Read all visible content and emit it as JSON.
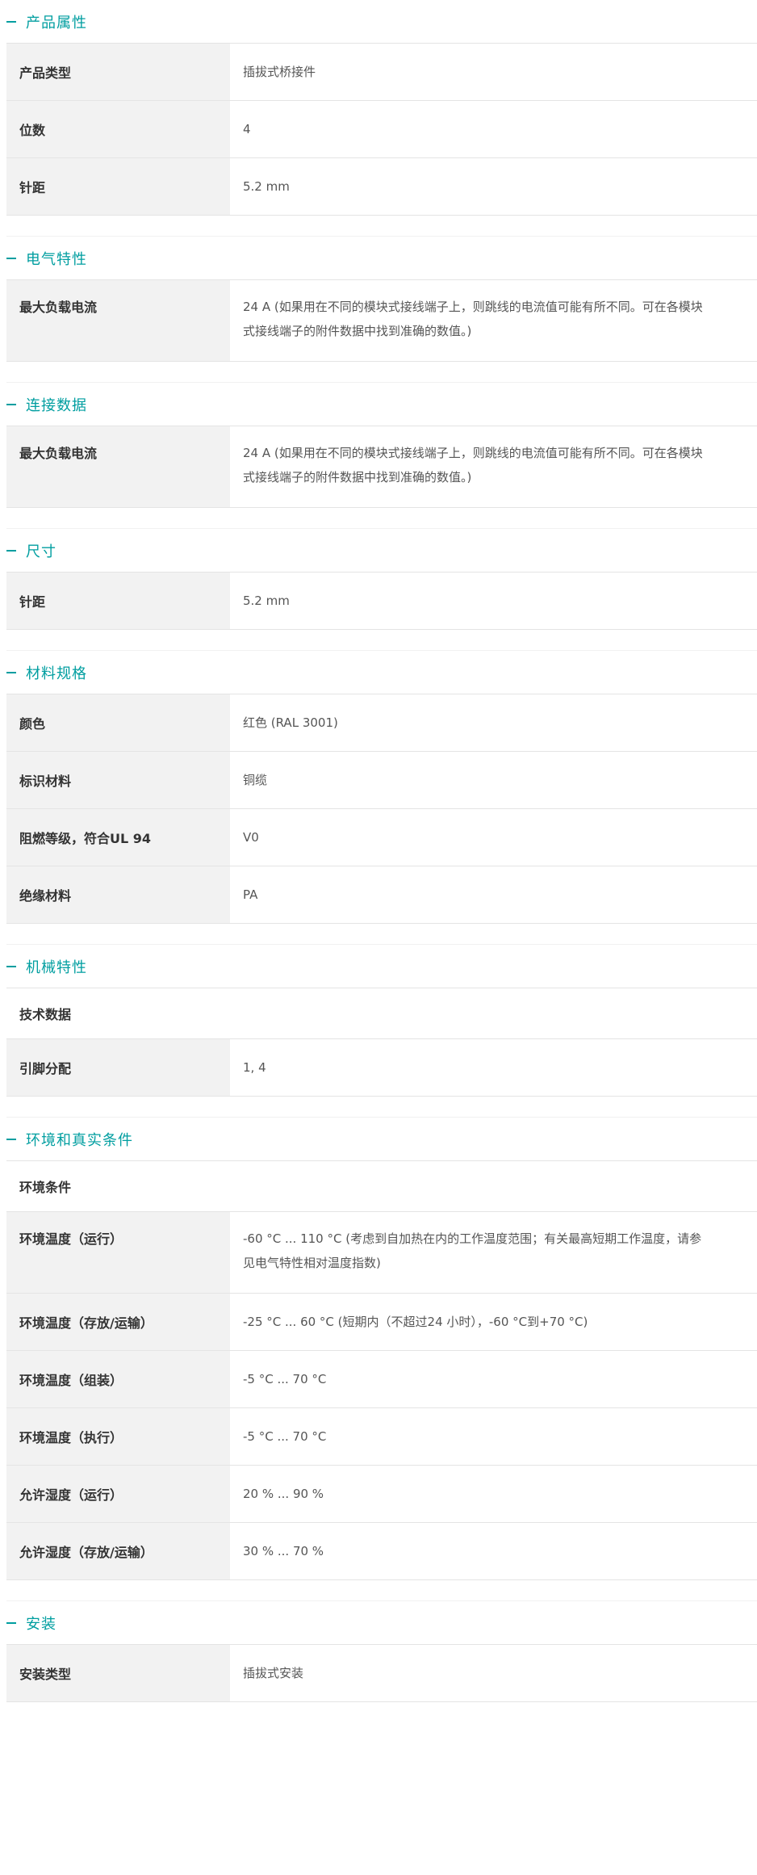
{
  "sections": [
    {
      "title": "产品属性",
      "rows": [
        {
          "key": "产品类型",
          "value": "插拔式桥接件"
        },
        {
          "key": "位数",
          "value": "4"
        },
        {
          "key": "针距",
          "value": "5.2 mm"
        }
      ]
    },
    {
      "title": "电气特性",
      "rows": [
        {
          "key": "最大负载电流",
          "value_line1": "24 A (如果用在不同的模块式接线端子上，则跳线的电流值可能有所不同。可在各模块",
          "value_line2": "式接线端子的附件数据中找到准确的数值。)"
        }
      ]
    },
    {
      "title": "连接数据",
      "rows": [
        {
          "key": "最大负载电流",
          "value_line1": "24 A (如果用在不同的模块式接线端子上，则跳线的电流值可能有所不同。可在各模块",
          "value_line2": "式接线端子的附件数据中找到准确的数值。)"
        }
      ]
    },
    {
      "title": "尺寸",
      "rows": [
        {
          "key": "针距",
          "value": "5.2 mm"
        }
      ]
    },
    {
      "title": "材料规格",
      "rows": [
        {
          "key": "颜色",
          "value": "红色 (RAL 3001)"
        },
        {
          "key": "标识材料",
          "value": "铜缆"
        },
        {
          "key": "阻燃等级，符合UL 94",
          "value": "V0"
        },
        {
          "key": "绝缘材料",
          "value": "PA"
        }
      ]
    },
    {
      "title": "机械特性",
      "subhead": "技术数据",
      "rows": [
        {
          "key": "引脚分配",
          "value": "1, 4"
        }
      ]
    },
    {
      "title": "环境和真实条件",
      "subhead": "环境条件",
      "rows": [
        {
          "key": "环境温度（运行）",
          "value_line1": "-60 °C ... 110 °C (考虑到自加热在内的工作温度范围；有关最高短期工作温度，请参",
          "value_line2": "见电气特性相对温度指数)"
        },
        {
          "key": "环境温度（存放/运输）",
          "value": "-25 °C ... 60 °C (短期内（不超过24  小时），-60 °C到+70 °C)"
        },
        {
          "key": "环境温度（组装）",
          "value": "-5 °C ... 70 °C"
        },
        {
          "key": "环境温度（执行）",
          "value": "-5 °C ... 70 °C"
        },
        {
          "key": "允许湿度（运行）",
          "value": "20 % ... 90 %"
        },
        {
          "key": "允许湿度（存放/运输）",
          "value": "30 % ... 70 %"
        }
      ]
    },
    {
      "title": "安装",
      "rows": [
        {
          "key": "安装类型",
          "value": "插拔式安装"
        }
      ]
    }
  ],
  "colors": {
    "accent": "#009ea0",
    "key_bg": "#f2f2f2",
    "border": "#e4e4e4"
  }
}
